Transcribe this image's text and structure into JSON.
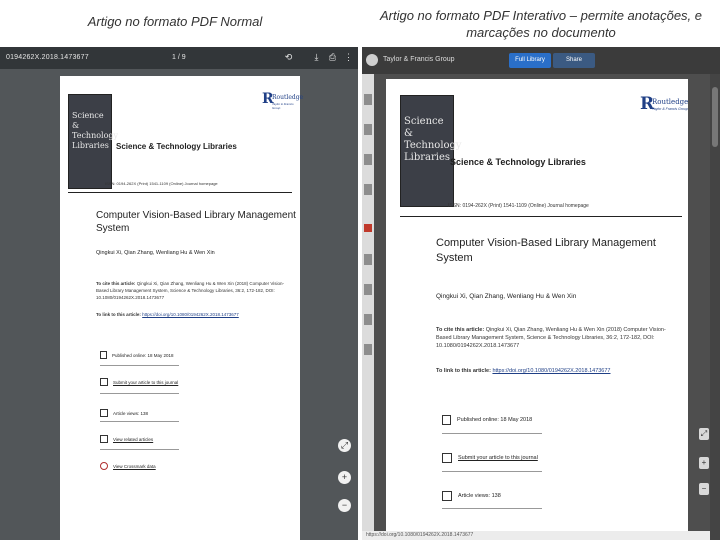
{
  "captions": {
    "left": "Artigo no formato PDF Normal",
    "right": "Artigo no formato PDF Interativo – permite anotações, e marcações no documento"
  },
  "article": {
    "journal_cover_title": "Science & Technology Libraries",
    "journal_name": "Science & Technology Libraries",
    "publisher_logo": "Routledge",
    "publisher_sub": "Taylor & Francis Group",
    "title_line1": "Computer Vision-Based Library Management",
    "title_line2": "System",
    "authors": "Qingkui Xi, Qian Zhang, Wenliang Hu & Wen Xin",
    "cite_label": "To cite this article: ",
    "cite_text": "Qingkui Xi, Qian Zhang, Wenliang Hu & Wen Xin (2018) Computer Vision-Based Library Management System, Science & Technology Libraries, 36:2, 172-182, DOI: 10.1080/0194262X.2018.1473677",
    "link_label": "To link to this article: ",
    "link_url": "https://doi.org/10.1080/0194262X.2018.1473677",
    "published": "Published online: 18 May 2018",
    "submit": "Submit your article to this journal",
    "views": "Article views: 138",
    "related": "View related articles",
    "crossmark": "View Crossmark data"
  },
  "viewer_left": {
    "doc_id": "0194262X.2018.1473677",
    "page_indicator": "1 / 9",
    "icons": [
      "rotate-icon",
      "download-icon",
      "print-icon",
      "more-icon"
    ]
  },
  "viewer_right": {
    "brand": "Taylor & Francis Group",
    "btn_full": "Full Library",
    "btn_share": "Share"
  }
}
